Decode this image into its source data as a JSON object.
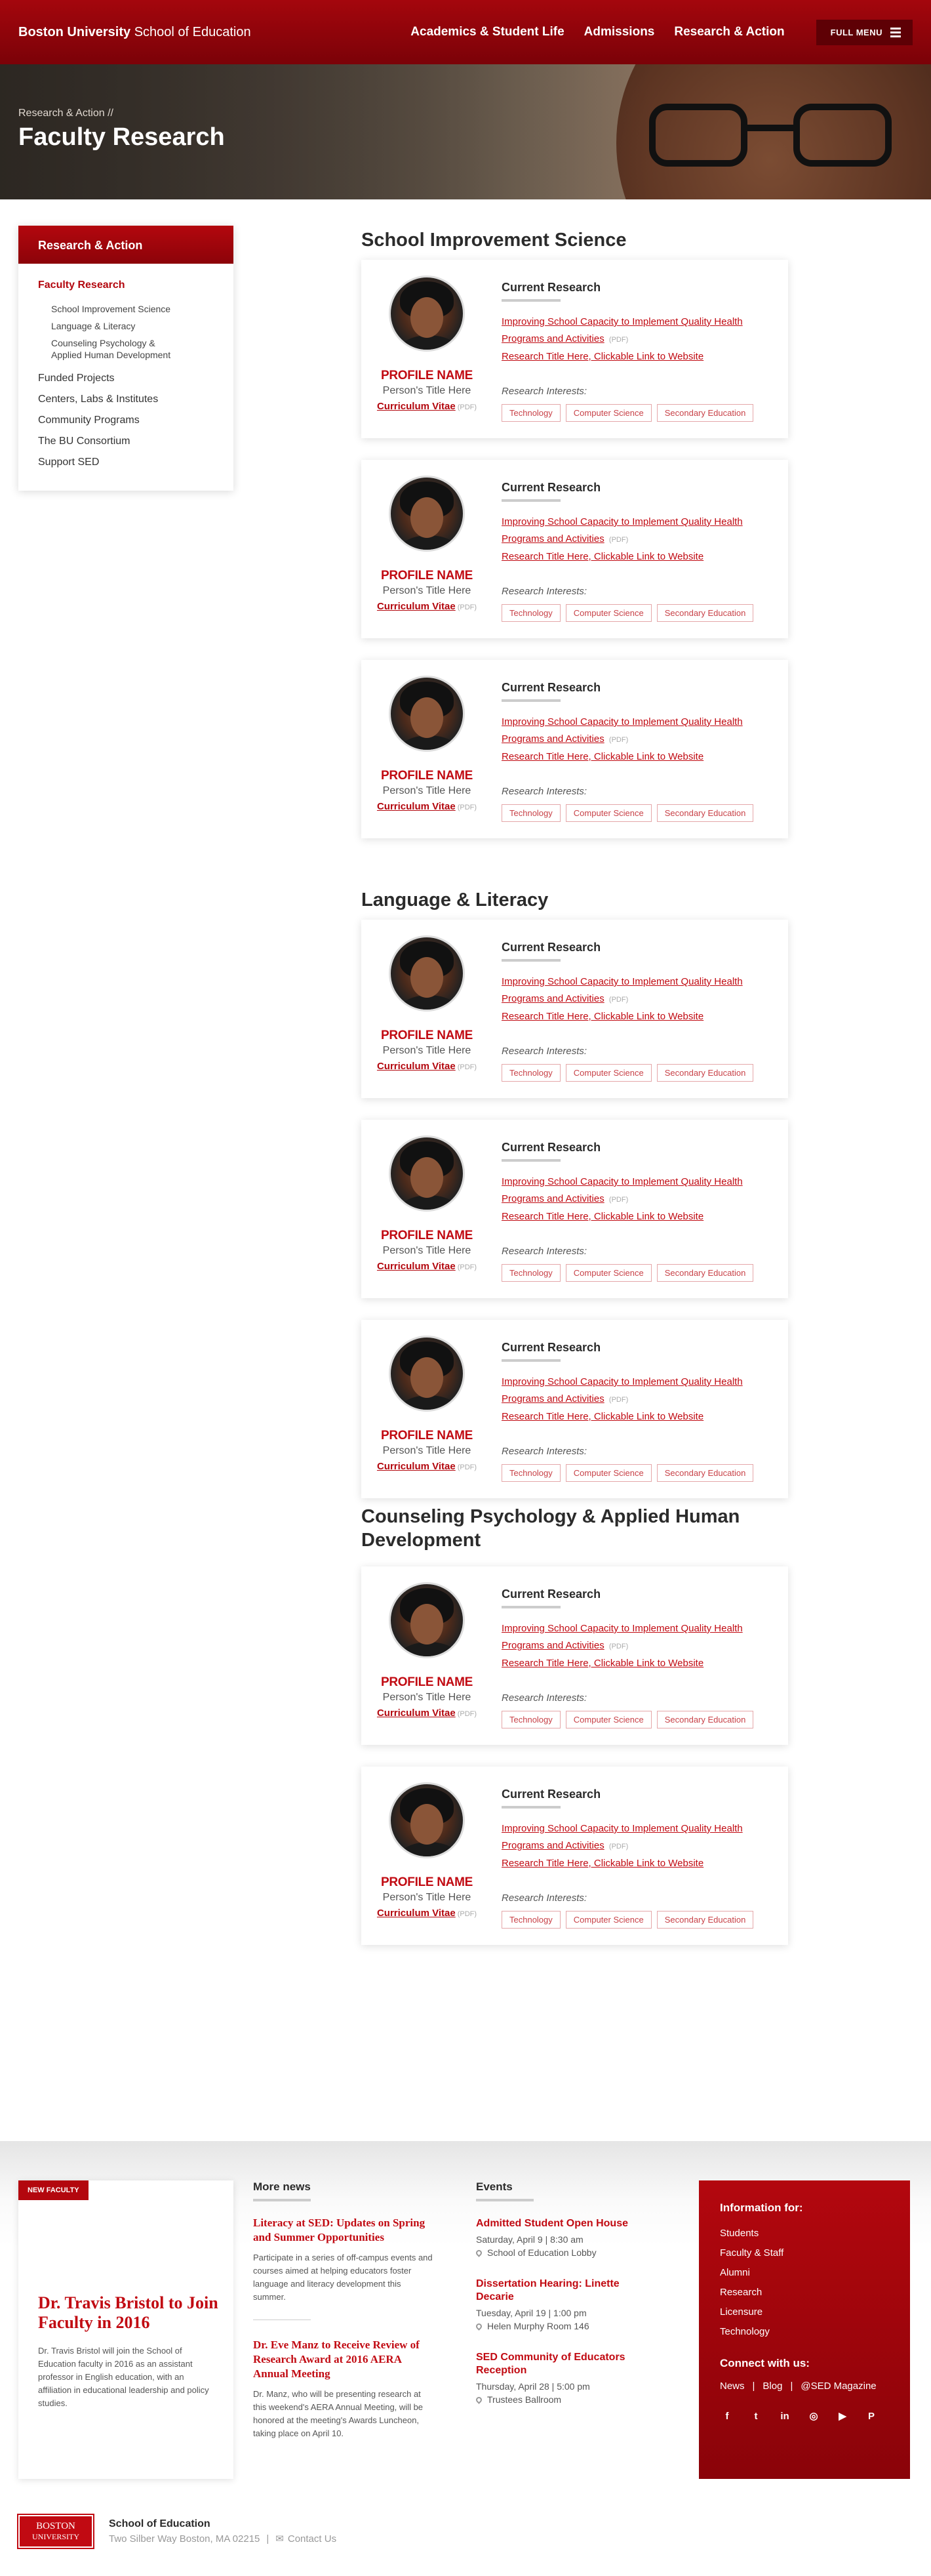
{
  "header": {
    "brand_bold": "Boston University",
    "brand_rest": " School of Education",
    "nav": [
      "Academics & Student Life",
      "Admissions",
      "Research & Action"
    ],
    "full_menu": "FULL MENU"
  },
  "hero": {
    "crumb": "Research & Action //",
    "title": "Faculty Research"
  },
  "sidebar": {
    "heading": "Research & Action",
    "active": "Faculty Research",
    "subitems": [
      "School Improvement Science",
      "Language & Literacy",
      "Counseling Psychology & Applied Human Development"
    ],
    "items": [
      "Funded Projects",
      "Centers, Labs & Institutes",
      "Community Programs",
      "The BU Consortium",
      "Support SED"
    ]
  },
  "profile": {
    "name": "PROFILE NAME",
    "title": "Person's Title Here",
    "cv": "Curriculum Vitae",
    "pdf": "(PDF)",
    "current_research": "Current Research",
    "link1": "Improving School Capacity to Implement Quality Health Programs and Activities",
    "link1_pdf": "(PDF)",
    "link2": "Research Title Here, Clickable Link to Website",
    "interests_label": "Research Interests:",
    "tags": [
      "Technology",
      "Computer Science",
      "Secondary Education"
    ]
  },
  "sections": [
    {
      "title": "School Improvement Science",
      "cards": 3
    },
    {
      "title": "Language & Literacy",
      "cards": 3
    },
    {
      "title": "Counseling Psychology & Applied Human Development",
      "cards": 2
    }
  ],
  "footer": {
    "new_faculty": {
      "badge": "NEW FACULTY",
      "title": "Dr. Travis Bristol to Join Faculty in 2016",
      "text": "Dr. Travis Bristol will join the School of Education faculty in 2016 as an assistant professor in English education, with an affiliation in educational leadership and policy studies."
    },
    "news": {
      "heading": "More news",
      "items": [
        {
          "title": "Literacy at SED: Updates on Spring and Summer Opportunities",
          "text": "Participate in a series of off-campus events and courses aimed at helping educators foster language and literacy development this summer."
        },
        {
          "title": "Dr. Eve Manz to Receive Review of Research Award at 2016 AERA Annual Meeting",
          "text": "Dr. Manz, who will be presenting research at this weekend's AERA Annual Meeting, will be honored at the meeting's Awards Luncheon, taking place on April 10."
        }
      ]
    },
    "events": {
      "heading": "Events",
      "items": [
        {
          "title": "Admitted Student Open House",
          "date": "Saturday, April 9 | 8:30 am",
          "location": "School of Education Lobby"
        },
        {
          "title": "Dissertation Hearing: Linette Decarie",
          "date": "Tuesday, April 19 | 1:00 pm",
          "location": "Helen Murphy Room 146"
        },
        {
          "title": "SED Community of Educators Reception",
          "date": "Thursday, April 28 | 5:00 pm",
          "location": "Trustees Ballroom"
        }
      ]
    },
    "info": {
      "heading": "Information for:",
      "links": [
        "Students",
        "Faculty & Staff",
        "Alumni",
        "Research",
        "Licensure",
        "Technology"
      ],
      "connect": "Connect with us:",
      "social": [
        "News",
        "Blog",
        "@SED Magazine"
      ],
      "icons": [
        "facebook-icon",
        "twitter-icon",
        "linkedin-icon",
        "instagram-icon",
        "youtube-icon",
        "pinterest-icon"
      ]
    },
    "bottom": {
      "logo_line1": "BOSTON",
      "logo_line2": "UNIVERSITY",
      "school": "School of Education",
      "address": "Two Silber Way Boston, MA 02215",
      "contact": "Contact Us"
    }
  },
  "colors": {
    "brand_red": "#b3070e",
    "link_red": "#c10a12"
  }
}
